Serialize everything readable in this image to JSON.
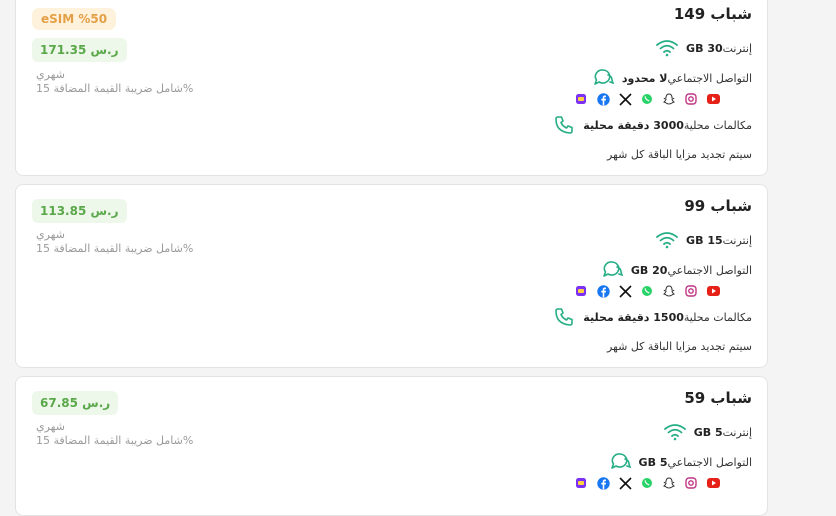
{
  "colors": {
    "accent": "#27ae85",
    "price_bg": "#edf8eb",
    "price_text": "#5aa84a",
    "badge_bg": "#fff2dc",
    "badge_text": "#e4a046"
  },
  "plans": [
    {
      "name": "شباب 149",
      "badge": "eSIM %50",
      "price": "171.35 ر.س",
      "period": "شهري",
      "vat": "شامل ضريبة القيمة المضافة 15%",
      "internet_value": "30 GB",
      "internet_label": "إنترنت",
      "social_value": "لا محدود",
      "social_label": "التواصل الاجتماعي",
      "calls_value": "3000 دقيقة محلية",
      "calls_label": "مكالمات محلية",
      "renew": "سيتم تجديد مزايا الباقة كل شهر"
    },
    {
      "name": "شباب 99",
      "price": "113.85 ر.س",
      "period": "شهري",
      "vat": "شامل ضريبة القيمة المضافة 15%",
      "internet_value": "15 GB",
      "internet_label": "إنترنت",
      "social_value": "20 GB",
      "social_label": "التواصل الاجتماعي",
      "calls_value": "1500 دقيقة محلية",
      "calls_label": "مكالمات محلية",
      "renew": "سيتم تجديد مزايا الباقة كل شهر"
    },
    {
      "name": "شباب 59",
      "price": "67.85 ر.س",
      "period": "شهري",
      "vat": "شامل ضريبة القيمة المضافة 15%",
      "internet_value": "5 GB",
      "internet_label": "إنترنت",
      "social_value": "5 GB",
      "social_label": "التواصل الاجتماعي"
    }
  ],
  "social_apps": [
    "youtube-icon",
    "instagram-icon",
    "snapchat-icon",
    "whatsapp-icon",
    "x-icon",
    "facebook-icon",
    "app-icon"
  ]
}
